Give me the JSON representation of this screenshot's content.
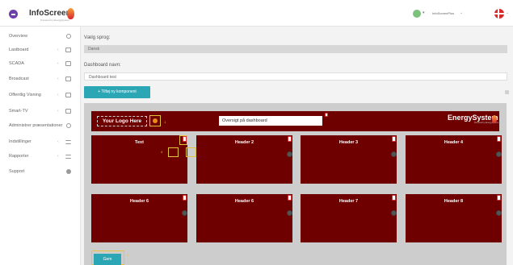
{
  "topbar": {
    "brand": "InfoScreen",
    "brand_sub": "Powered by EnergySystem",
    "user_name": "InfoScreenPlus",
    "user_chev": "⌄",
    "flag_chev": "⌄",
    "caret": "▾"
  },
  "sidebar": {
    "items": [
      {
        "label": "Overview",
        "chev": "",
        "icon": "round"
      },
      {
        "label": "Lastboard",
        "chev": "‹",
        "icon": "box"
      },
      {
        "label": "SCADA",
        "chev": "‹",
        "icon": "box"
      },
      {
        "label": "Broadcast",
        "chev": "‹",
        "icon": "box"
      },
      {
        "label": "Offentlig Visning",
        "chev": "‹",
        "icon": "box"
      },
      {
        "label": "Smart-TV",
        "chev": "‹",
        "icon": "box"
      },
      {
        "label": "Administrer præsentationer",
        "chev": "‹",
        "icon": "round"
      },
      {
        "label": "Indstillinger",
        "chev": "‹",
        "icon": "bars"
      },
      {
        "label": "Rapporter",
        "chev": "‹",
        "icon": "bars"
      },
      {
        "label": "Support",
        "chev": "",
        "icon": "dot"
      }
    ]
  },
  "form": {
    "language_label": "Vælg sprog:",
    "language_value": "Dansk",
    "dashboard_name_label": "Dashboard navn:",
    "dashboard_name_value": "Dashboard test",
    "add_button": "+ Tilføj ny komponent"
  },
  "board": {
    "logo_placeholder": "Your Logo Here",
    "title_value": "Oversigt på dashboard",
    "brand_logo": "EnergySystem",
    "brand_logo_sub": "Powered by EnergySystem",
    "marks": {
      "header": "1",
      "widget_left": "4",
      "widget_right": "3",
      "save": "5"
    },
    "widgets": [
      {
        "title": "Text"
      },
      {
        "title": "Header 2"
      },
      {
        "title": "Header 3"
      },
      {
        "title": "Header 4"
      },
      {
        "title": "Header 6"
      },
      {
        "title": "Header 6"
      },
      {
        "title": "Header 7"
      },
      {
        "title": "Header 8"
      }
    ],
    "save_button": "Gem"
  },
  "colors": {
    "accent": "#2ba6b5",
    "board_bg": "#6e0000",
    "highlight": "#e7c23a"
  }
}
